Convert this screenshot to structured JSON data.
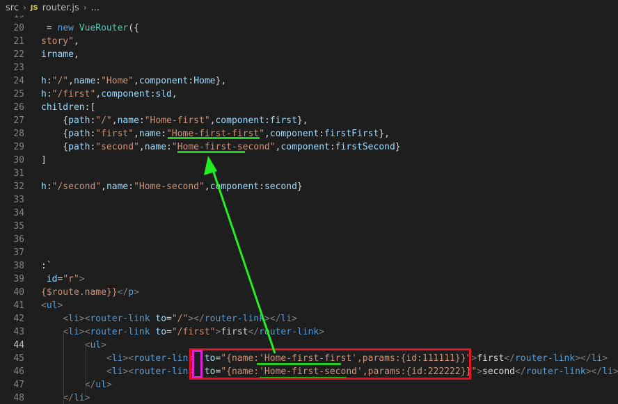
{
  "breadcrumb": {
    "folder": "src",
    "file_icon": "JS",
    "file": "router.js",
    "more": "..."
  },
  "colors": {
    "keyword": "#569cd6",
    "string": "#ce9178",
    "property": "#9cdcfe",
    "class": "#4ec9b0",
    "plain": "#d4d4d4",
    "tag": "#569cd6",
    "tag_bracket": "#808080",
    "attr": "#9cdcfe",
    "annotation_green": "#22cc22",
    "annotation_red": "#e81123",
    "annotation_pink": "#e020e0"
  },
  "editor": {
    "active_line": "44",
    "top_partial_line": "19",
    "lines": [
      {
        "n": "20",
        "tokens": [
          {
            "t": " = ",
            "c": "plain"
          },
          {
            "t": "new",
            "c": "keyword"
          },
          {
            "t": " ",
            "c": "plain"
          },
          {
            "t": "VueRouter",
            "c": "class"
          },
          {
            "t": "({",
            "c": "plain"
          }
        ]
      },
      {
        "n": "21",
        "tokens": [
          {
            "t": "story\"",
            "c": "string"
          },
          {
            "t": ",",
            "c": "plain"
          }
        ]
      },
      {
        "n": "22",
        "tokens": [
          {
            "t": "irname",
            "c": "property"
          },
          {
            "t": ",",
            "c": "plain"
          }
        ]
      },
      {
        "n": "23",
        "tokens": []
      },
      {
        "n": "24",
        "tokens": [
          {
            "t": "h",
            "c": "property"
          },
          {
            "t": ":",
            "c": "plain"
          },
          {
            "t": "\"/\"",
            "c": "string"
          },
          {
            "t": ",",
            "c": "plain"
          },
          {
            "t": "name",
            "c": "property"
          },
          {
            "t": ":",
            "c": "plain"
          },
          {
            "t": "\"Home\"",
            "c": "string"
          },
          {
            "t": ",",
            "c": "plain"
          },
          {
            "t": "component",
            "c": "property"
          },
          {
            "t": ":",
            "c": "plain"
          },
          {
            "t": "Home",
            "c": "property"
          },
          {
            "t": "},",
            "c": "plain"
          }
        ]
      },
      {
        "n": "25",
        "tokens": [
          {
            "t": "h",
            "c": "property"
          },
          {
            "t": ":",
            "c": "plain"
          },
          {
            "t": "\"/first\"",
            "c": "string"
          },
          {
            "t": ",",
            "c": "plain"
          },
          {
            "t": "component",
            "c": "property"
          },
          {
            "t": ":",
            "c": "plain"
          },
          {
            "t": "sld",
            "c": "property"
          },
          {
            "t": ",",
            "c": "plain"
          }
        ]
      },
      {
        "n": "26",
        "tokens": [
          {
            "t": "children",
            "c": "property"
          },
          {
            "t": ":[",
            "c": "plain"
          }
        ]
      },
      {
        "n": "27",
        "tokens": [
          {
            "t": "    {",
            "c": "plain"
          },
          {
            "t": "path",
            "c": "property"
          },
          {
            "t": ":",
            "c": "plain"
          },
          {
            "t": "\"/\"",
            "c": "string"
          },
          {
            "t": ",",
            "c": "plain"
          },
          {
            "t": "name",
            "c": "property"
          },
          {
            "t": ":",
            "c": "plain"
          },
          {
            "t": "\"Home-first\"",
            "c": "string"
          },
          {
            "t": ",",
            "c": "plain"
          },
          {
            "t": "component",
            "c": "property"
          },
          {
            "t": ":",
            "c": "plain"
          },
          {
            "t": "first",
            "c": "property"
          },
          {
            "t": "},",
            "c": "plain"
          }
        ]
      },
      {
        "n": "28",
        "tokens": [
          {
            "t": "    {",
            "c": "plain"
          },
          {
            "t": "path",
            "c": "property"
          },
          {
            "t": ":",
            "c": "plain"
          },
          {
            "t": "\"first\"",
            "c": "string"
          },
          {
            "t": ",",
            "c": "plain"
          },
          {
            "t": "name",
            "c": "property"
          },
          {
            "t": ":",
            "c": "plain"
          },
          {
            "t": "\"Home-first-first\"",
            "c": "string"
          },
          {
            "t": ",",
            "c": "plain"
          },
          {
            "t": "component",
            "c": "property"
          },
          {
            "t": ":",
            "c": "plain"
          },
          {
            "t": "firstFirst",
            "c": "property"
          },
          {
            "t": "},",
            "c": "plain"
          }
        ]
      },
      {
        "n": "29",
        "tokens": [
          {
            "t": "    {",
            "c": "plain"
          },
          {
            "t": "path",
            "c": "property"
          },
          {
            "t": ":",
            "c": "plain"
          },
          {
            "t": "\"second\"",
            "c": "string"
          },
          {
            "t": ",",
            "c": "plain"
          },
          {
            "t": "name",
            "c": "property"
          },
          {
            "t": ":",
            "c": "plain"
          },
          {
            "t": "\"Home-first-second\"",
            "c": "string"
          },
          {
            "t": ",",
            "c": "plain"
          },
          {
            "t": "component",
            "c": "property"
          },
          {
            "t": ":",
            "c": "plain"
          },
          {
            "t": "firstSecond",
            "c": "property"
          },
          {
            "t": "}",
            "c": "plain"
          }
        ]
      },
      {
        "n": "30",
        "tokens": [
          {
            "t": "]",
            "c": "plain"
          }
        ]
      },
      {
        "n": "31",
        "tokens": []
      },
      {
        "n": "32",
        "tokens": [
          {
            "t": "h",
            "c": "property"
          },
          {
            "t": ":",
            "c": "plain"
          },
          {
            "t": "\"/second\"",
            "c": "string"
          },
          {
            "t": ",",
            "c": "plain"
          },
          {
            "t": "name",
            "c": "property"
          },
          {
            "t": ":",
            "c": "plain"
          },
          {
            "t": "\"Home-second\"",
            "c": "string"
          },
          {
            "t": ",",
            "c": "plain"
          },
          {
            "t": "component",
            "c": "property"
          },
          {
            "t": ":",
            "c": "plain"
          },
          {
            "t": "second",
            "c": "property"
          },
          {
            "t": "}",
            "c": "plain"
          }
        ]
      },
      {
        "n": "33",
        "tokens": []
      },
      {
        "n": "34",
        "tokens": []
      },
      {
        "n": "35",
        "tokens": []
      },
      {
        "n": "36",
        "tokens": []
      },
      {
        "n": "37",
        "tokens": []
      },
      {
        "n": "38",
        "tokens": [
          {
            "t": ":`",
            "c": "plain"
          }
        ]
      },
      {
        "n": "39",
        "tokens": [
          {
            "t": " id",
            "c": "attr"
          },
          {
            "t": "=",
            "c": "plain"
          },
          {
            "t": "\"r\"",
            "c": "string"
          },
          {
            "t": ">",
            "c": "tag_bracket"
          }
        ]
      },
      {
        "n": "40",
        "tokens": [
          {
            "t": "{$route.name}}",
            "c": "string"
          },
          {
            "t": "</",
            "c": "tag_bracket"
          },
          {
            "t": "p",
            "c": "tag"
          },
          {
            "t": ">",
            "c": "tag_bracket"
          }
        ]
      },
      {
        "n": "41",
        "tokens": [
          {
            "t": "<",
            "c": "tag_bracket"
          },
          {
            "t": "ul",
            "c": "tag"
          },
          {
            "t": ">",
            "c": "tag_bracket"
          }
        ]
      },
      {
        "n": "42",
        "tokens": [
          {
            "t": "    <",
            "c": "tag_bracket"
          },
          {
            "t": "li",
            "c": "tag"
          },
          {
            "t": "><",
            "c": "tag_bracket"
          },
          {
            "t": "router-link",
            "c": "tag"
          },
          {
            "t": " to",
            "c": "attr"
          },
          {
            "t": "=",
            "c": "plain"
          },
          {
            "t": "\"/\"",
            "c": "string"
          },
          {
            "t": "></",
            "c": "tag_bracket"
          },
          {
            "t": "router-link",
            "c": "tag"
          },
          {
            "t": "></",
            "c": "tag_bracket"
          },
          {
            "t": "li",
            "c": "tag"
          },
          {
            "t": ">",
            "c": "tag_bracket"
          }
        ]
      },
      {
        "n": "43",
        "tokens": [
          {
            "t": "    <",
            "c": "tag_bracket"
          },
          {
            "t": "li",
            "c": "tag"
          },
          {
            "t": "><",
            "c": "tag_bracket"
          },
          {
            "t": "router-link",
            "c": "tag"
          },
          {
            "t": " to",
            "c": "attr"
          },
          {
            "t": "=",
            "c": "plain"
          },
          {
            "t": "\"/first\"",
            "c": "string"
          },
          {
            "t": ">",
            "c": "tag_bracket"
          },
          {
            "t": "first",
            "c": "plain"
          },
          {
            "t": "</",
            "c": "tag_bracket"
          },
          {
            "t": "router-link",
            "c": "tag"
          },
          {
            "t": ">",
            "c": "tag_bracket"
          }
        ]
      },
      {
        "n": "44",
        "tokens": [
          {
            "t": "        <",
            "c": "tag_bracket"
          },
          {
            "t": "ul",
            "c": "tag"
          },
          {
            "t": ">",
            "c": "tag_bracket"
          }
        ]
      },
      {
        "n": "45",
        "tokens": [
          {
            "t": "            <",
            "c": "tag_bracket"
          },
          {
            "t": "li",
            "c": "tag"
          },
          {
            "t": "><",
            "c": "tag_bracket"
          },
          {
            "t": "router-link",
            "c": "tag"
          },
          {
            "t": " :",
            "c": "plain"
          },
          {
            "t": "to",
            "c": "attr"
          },
          {
            "t": "=",
            "c": "plain"
          },
          {
            "t": "\"{name:",
            "c": "string"
          },
          {
            "t": "'Home-first-first'",
            "c": "string"
          },
          {
            "t": ",params:{id:111111}}\"",
            "c": "string"
          },
          {
            "t": ">",
            "c": "tag_bracket"
          },
          {
            "t": "first",
            "c": "plain"
          },
          {
            "t": "</",
            "c": "tag_bracket"
          },
          {
            "t": "router-link",
            "c": "tag"
          },
          {
            "t": "></",
            "c": "tag_bracket"
          },
          {
            "t": "li",
            "c": "tag"
          },
          {
            "t": ">",
            "c": "tag_bracket"
          }
        ]
      },
      {
        "n": "46",
        "tokens": [
          {
            "t": "            <",
            "c": "tag_bracket"
          },
          {
            "t": "li",
            "c": "tag"
          },
          {
            "t": "><",
            "c": "tag_bracket"
          },
          {
            "t": "router-link",
            "c": "tag"
          },
          {
            "t": " :",
            "c": "plain"
          },
          {
            "t": "to",
            "c": "attr"
          },
          {
            "t": "=",
            "c": "plain"
          },
          {
            "t": "\"{name:",
            "c": "string"
          },
          {
            "t": "'Home-first-second'",
            "c": "string"
          },
          {
            "t": ",params:{id:222222}}\"",
            "c": "string"
          },
          {
            "t": ">",
            "c": "tag_bracket"
          },
          {
            "t": "second",
            "c": "plain"
          },
          {
            "t": "</",
            "c": "tag_bracket"
          },
          {
            "t": "router-link",
            "c": "tag"
          },
          {
            "t": "></",
            "c": "tag_bracket"
          },
          {
            "t": "li",
            "c": "tag"
          },
          {
            "t": ">",
            "c": "tag_bracket"
          }
        ]
      },
      {
        "n": "47",
        "tokens": [
          {
            "t": "        </",
            "c": "tag_bracket"
          },
          {
            "t": "ul",
            "c": "tag"
          },
          {
            "t": ">",
            "c": "tag_bracket"
          }
        ]
      },
      {
        "n": "48",
        "tokens": [
          {
            "t": "    </",
            "c": "tag_bracket"
          },
          {
            "t": "li",
            "c": "tag"
          },
          {
            "t": ">",
            "c": "tag_bracket"
          }
        ]
      }
    ]
  }
}
